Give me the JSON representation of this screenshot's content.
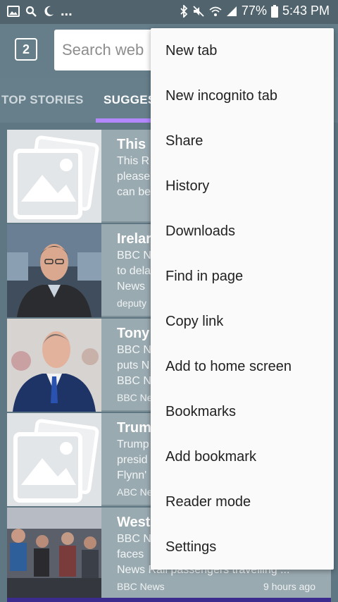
{
  "status_bar": {
    "icons_left": [
      "image-icon",
      "search-icon",
      "moon-icon"
    ],
    "ellipsis": "...",
    "icons_right": [
      "bluetooth-icon",
      "mute-icon",
      "wifi-icon",
      "signal-icon",
      "battery-icon"
    ],
    "battery": "77%",
    "time": "5:43 PM"
  },
  "toolbar": {
    "tab_count": "2",
    "search_placeholder": "Search web"
  },
  "category_tabs": [
    {
      "label": "TOP STORIES",
      "active": false
    },
    {
      "label": "SUGGES",
      "active": true
    }
  ],
  "accent_color": "#b388ff",
  "feed": [
    {
      "title": "This",
      "snippet": [
        "This R",
        "please",
        "can be"
      ],
      "source": "",
      "time": "",
      "thumb": "placeholder"
    },
    {
      "title": "Irelar",
      "snippet": [
        "BBC N",
        "to dela",
        "News"
      ],
      "source": "deputy",
      "time": "",
      "thumb": "man-glasses"
    },
    {
      "title": "Tony",
      "snippet": [
        "BBC N",
        "puts N",
        "BBC N"
      ],
      "source": "BBC Ne",
      "time": "",
      "thumb": "man-suit"
    },
    {
      "title": "Trum",
      "snippet": [
        "Trump",
        "presid",
        "Flynn'"
      ],
      "source": "ABC Ne",
      "time": "",
      "thumb": "placeholder"
    },
    {
      "title": "West",
      "snippet": [
        "BBC N",
        "faces",
        "News Rail passengers travelling ..."
      ],
      "source": "BBC News",
      "time": "9 hours ago",
      "thumb": "crowd"
    }
  ],
  "menu": {
    "items": [
      "New tab",
      "New incognito tab",
      "Share",
      "History",
      "Downloads",
      "Find in page",
      "Copy link",
      "Add to home screen",
      "Bookmarks",
      "Add bookmark",
      "Reader mode",
      "Settings"
    ]
  }
}
